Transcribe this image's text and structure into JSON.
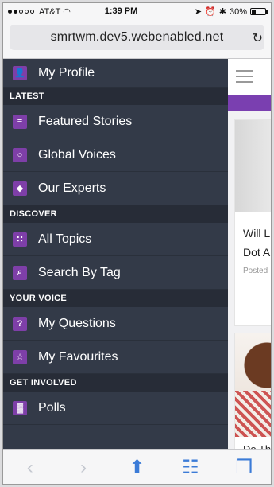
{
  "status_bar": {
    "carrier": "AT&T",
    "time": "1:39 PM",
    "battery": "30%",
    "battery_level": 0.3
  },
  "browser": {
    "url": "smrtwm.dev5.webenabled.net"
  },
  "menu": {
    "profile": {
      "label": "My Profile",
      "icon": "person-icon"
    },
    "sections": [
      {
        "title": "LATEST",
        "items": [
          {
            "label": "Featured Stories",
            "icon": "document-icon"
          },
          {
            "label": "Global Voices",
            "icon": "speech-bubble-icon"
          },
          {
            "label": "Our Experts",
            "icon": "shield-icon"
          }
        ]
      },
      {
        "title": "DISCOVER",
        "items": [
          {
            "label": "All Topics",
            "icon": "tree-icon"
          },
          {
            "label": "Search By Tag",
            "icon": "search-icon"
          }
        ]
      },
      {
        "title": "YOUR VOICE",
        "items": [
          {
            "label": "My Questions",
            "icon": "question-icon"
          },
          {
            "label": "My Favourites",
            "icon": "star-icon"
          }
        ]
      },
      {
        "title": "GET INVOLVED",
        "items": [
          {
            "label": "Polls",
            "icon": "bar-chart-icon"
          }
        ]
      }
    ]
  },
  "content": {
    "card1_title": "Will L… Dot A…",
    "card1_title_line1": "Will L",
    "card1_title_line2": "Dot A",
    "card1_meta": "Posted",
    "card2_title": "Do Th"
  },
  "colors": {
    "menu_bg": "#333a48",
    "section_bg": "#272c37",
    "accent": "#7e3fa8",
    "browser_blue": "#3b7bd7"
  }
}
